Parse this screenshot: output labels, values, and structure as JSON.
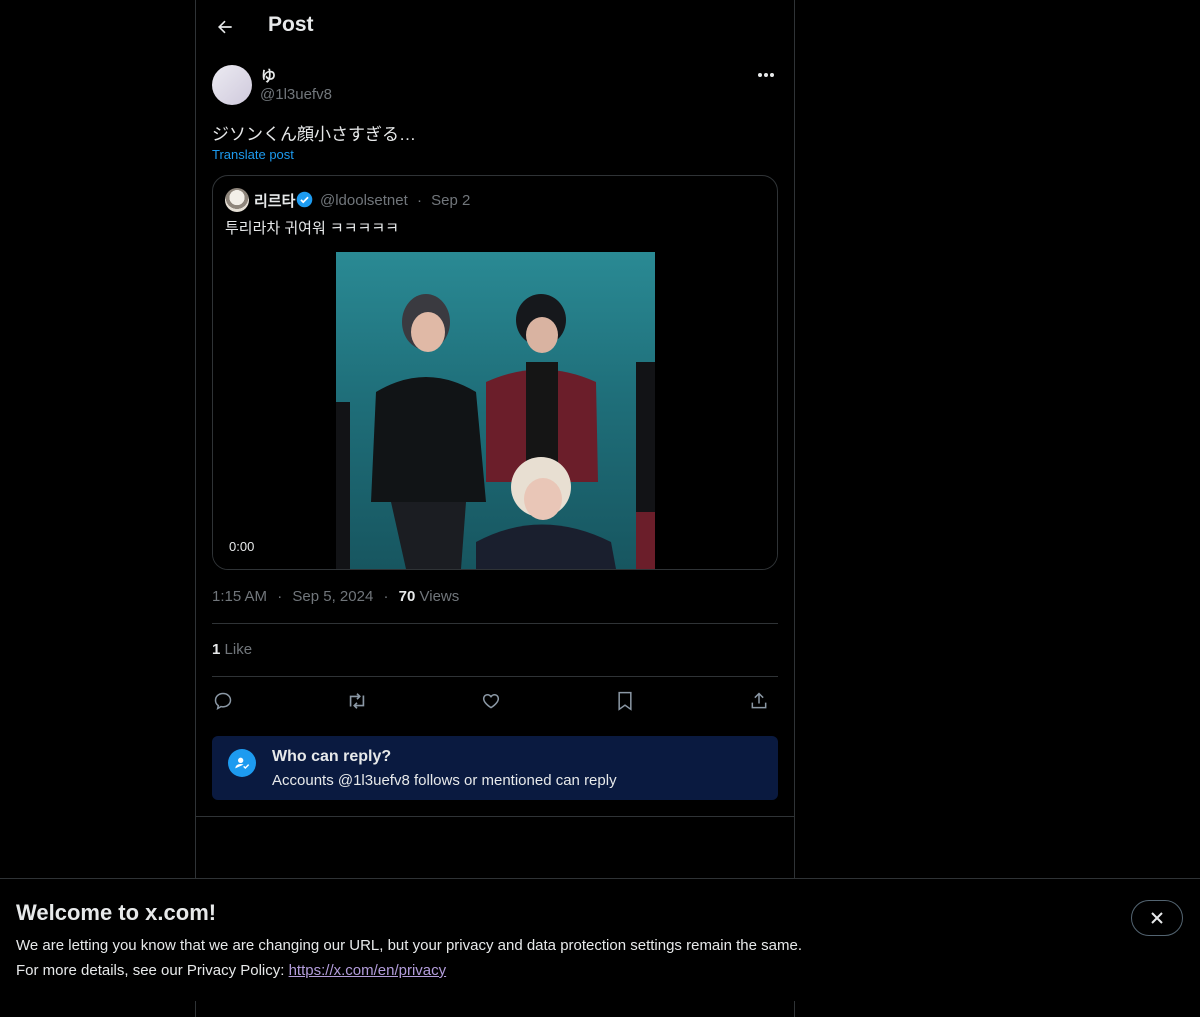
{
  "header": {
    "title": "Post"
  },
  "post": {
    "display_name": "ゆ",
    "handle": "@1l3uefv8",
    "text": "ジソンくん顔小さすぎる…",
    "translate": "Translate post",
    "time": "1:15 AM",
    "sep": "·",
    "date": "Sep 5, 2024",
    "views_count": "70",
    "views_label": "Views",
    "likes_count": "1",
    "likes_label": "Like"
  },
  "quote": {
    "name": "리르타",
    "handle": "@ldoolsetnet",
    "sep": "·",
    "date": "Sep 2",
    "text": "투리라차 귀여워 ㅋㅋㅋㅋㅋ",
    "video_time": "0:00"
  },
  "actions": [
    "reply-icon",
    "repost-icon",
    "like-icon",
    "bookmark-icon",
    "share-icon"
  ],
  "reply_settings": {
    "title": "Who can reply?",
    "subtitle": "Accounts @1l3uefv8 follows or mentioned can reply"
  },
  "banner": {
    "title": "Welcome to x.com!",
    "line1": "We are letting you know that we are changing our URL, but your privacy and data protection settings remain the same.",
    "line2_prefix": "For more details, see our Privacy Policy: ",
    "link": "https://x.com/en/privacy"
  },
  "colors": {
    "background": "#000000",
    "accent": "#1d9bf0",
    "muted_text": "#71767b",
    "border": "#2f3336",
    "reply_box": "#0a1a40"
  }
}
